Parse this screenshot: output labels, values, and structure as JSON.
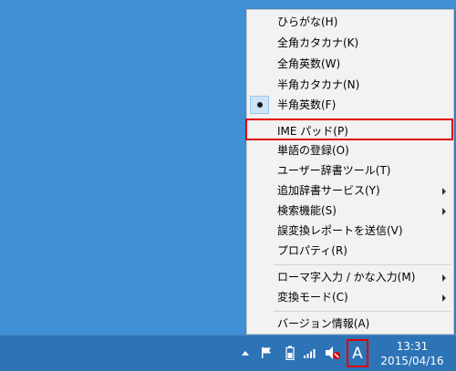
{
  "menu": {
    "items": [
      {
        "label": "ひらがな(H)"
      },
      {
        "label": "全角カタカナ(K)"
      },
      {
        "label": "全角英数(W)"
      },
      {
        "label": "半角カタカナ(N)"
      },
      {
        "label": "半角英数(F)",
        "checked": true
      },
      {
        "label": "IME パッド(P)",
        "highlighted": true
      },
      {
        "label": "単語の登録(O)"
      },
      {
        "label": "ユーザー辞書ツール(T)"
      },
      {
        "label": "追加辞書サービス(Y)",
        "submenu": true
      },
      {
        "label": "検索機能(S)",
        "submenu": true
      },
      {
        "label": "誤変換レポートを送信(V)"
      },
      {
        "label": "プロパティ(R)"
      },
      {
        "label": "ローマ字入力 / かな入力(M)",
        "submenu": true
      },
      {
        "label": "変換モード(C)",
        "submenu": true
      },
      {
        "label": "バージョン情報(A)"
      }
    ]
  },
  "taskbar": {
    "ime_indicator": "A",
    "time": "13:31",
    "date": "2015/04/16"
  },
  "icons": {
    "show_hidden": "chevron-up-icon",
    "flag": "action-center-flag-icon",
    "battery": "battery-icon",
    "network": "signal-bars-icon",
    "volume": "volume-muted-icon"
  },
  "colors": {
    "desktop": "#3f90d4",
    "taskbar": "#2d74b6",
    "highlight_border": "#e00000",
    "checked_bg": "#cde4f7"
  }
}
